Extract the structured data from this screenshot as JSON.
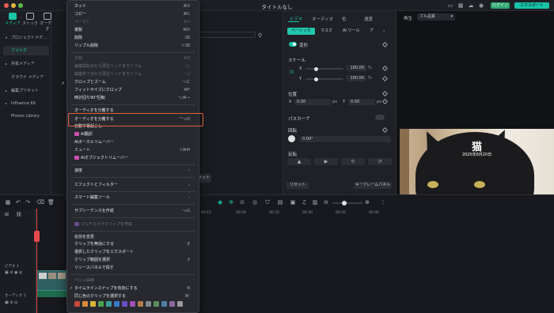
{
  "window": {
    "title": "タイトルなし",
    "login": "ログイン",
    "export": "エクスポート"
  },
  "topnav": [
    {
      "label": "メディア",
      "icon": "media-icon"
    },
    {
      "label": "ストック",
      "icon": "stock-icon"
    },
    {
      "label": "オーディオ",
      "icon": "audio-icon"
    }
  ],
  "sidebar": {
    "items": [
      {
        "label": "プロジェクトメデ…",
        "arrow": "▾",
        "selected": false
      },
      {
        "label": "フォルダ",
        "arrow": "",
        "selected": true
      },
      {
        "label": "共有メディア",
        "arrow": "▸",
        "selected": false
      },
      {
        "label": "クラウド メディア",
        "arrow": "",
        "selected": false
      },
      {
        "label": "編集プリセット",
        "arrow": "▸",
        "selected": false
      },
      {
        "label": "Influence Kit",
        "arrow": "▸",
        "selected": false
      },
      {
        "label": "Photos Library",
        "arrow": "",
        "selected": false
      }
    ],
    "partial_label": "メ",
    "import_partial": "セット"
  },
  "props": {
    "tabs": [
      "ビデオ",
      "オーディオ",
      "色",
      "速度"
    ],
    "subtabs": [
      "ベーシック",
      "マスク",
      "AI ツール",
      "ア"
    ],
    "transform_label": "変形",
    "scale_label": "スケール",
    "scale_x_value": "100.00",
    "scale_y_value": "100.00",
    "scale_unit": "%",
    "scale_x_axis": "X",
    "scale_y_axis": "Y",
    "position_label": "位置",
    "pos_x_value": "0.00",
    "pos_y_value": "0.00",
    "pos_unit": "px",
    "pos_x_axis": "X",
    "pos_y_axis": "Y",
    "perspective_label": "パスカーブ",
    "rotate_label": "回転",
    "rotate_value": "0.00°",
    "flip_label": "反転",
    "reset": "リセット",
    "keyframe_panel": "キーフレームパネル"
  },
  "preview": {
    "player": "再生",
    "quality": "フル品質",
    "overlay_title": "猫",
    "overlay_date": "2025年6月20日"
  },
  "timeline": {
    "ruler": [
      "00:00",
      "00:05",
      "00:10",
      "00:15",
      "00:20",
      "00:25",
      "00:30",
      "00:35",
      "00:40",
      "00:45",
      "00:50"
    ],
    "video_track": "ビデオ 1",
    "audio_track": "オーディオ 1"
  },
  "menu": {
    "items": [
      {
        "label": "カット",
        "shortcut": "⌘X",
        "disabled": false
      },
      {
        "label": "コピー",
        "shortcut": "⌘C",
        "disabled": false
      },
      {
        "label": "ペースト",
        "shortcut": "⌘V",
        "disabled": true
      },
      {
        "label": "複製",
        "shortcut": "⌘D",
        "disabled": false
      },
      {
        "label": "削除",
        "shortcut": "⌫",
        "disabled": false
      },
      {
        "label": "リップル削除",
        "shortcut": "⇧⌫",
        "disabled": false
      },
      {
        "label": "分割",
        "shortcut": "⌘B",
        "disabled": true
      },
      {
        "label": "編集開始点から再生ヘッドまでトリム",
        "shortcut": "⌥[",
        "disabled": true
      },
      {
        "label": "編集終了点から再生ヘッドまでトリム",
        "shortcut": "⌥]",
        "disabled": true
      },
      {
        "label": "クロップとズーム",
        "shortcut": "⌥C",
        "disabled": false
      },
      {
        "label": "フィットサイズにクロップ",
        "shortcut": "⌘F",
        "disabled": false
      },
      {
        "label": "時計回り90°回転",
        "shortcut": "⌥⌘→",
        "disabled": false
      },
      {
        "label": "オーディオを分離する",
        "shortcut": "",
        "disabled": false
      },
      {
        "label": "オーディオを分離する",
        "shortcut": "^⌥D",
        "disabled": false
      },
      {
        "label": "自動字幕起こし",
        "shortcut": "",
        "disabled": false
      },
      {
        "label": "AI翻訳",
        "shortcut": "",
        "disabled": false
      },
      {
        "label": "AIボーカルリムーバー",
        "shortcut": "",
        "disabled": false
      },
      {
        "label": "ミュート",
        "shortcut": "⇧⌘M",
        "disabled": false
      },
      {
        "label": "AIオブジェクトリムーバー",
        "shortcut": "",
        "disabled": false
      },
      {
        "label": "速度",
        "shortcut": "",
        "disabled": false
      },
      {
        "label": "エフェクトとフィルター",
        "shortcut": "",
        "disabled": false
      },
      {
        "label": "スマート編集ツール",
        "shortcut": "",
        "disabled": false
      },
      {
        "label": "サブシーケンスを作成",
        "shortcut": "⌥G",
        "disabled": false
      },
      {
        "label": "マルチカメラクリップを作成",
        "shortcut": "",
        "disabled": true
      },
      {
        "label": "名前を変更",
        "shortcut": "",
        "disabled": false
      },
      {
        "label": "クリップを無効にする",
        "shortcut": "E",
        "disabled": false
      },
      {
        "label": "選択したクリップをエクスポート",
        "shortcut": "",
        "disabled": false
      },
      {
        "label": "クリップ範囲を選択",
        "shortcut": "X",
        "disabled": false
      },
      {
        "label": "リソースパネルで探す",
        "shortcut": "",
        "disabled": false
      },
      {
        "label": "ベジェ曲線",
        "shortcut": "",
        "disabled": true
      },
      {
        "label": "タイムラインスナップを有効にする",
        "shortcut": "N",
        "disabled": false
      },
      {
        "label": "同じ色のクリップを選択する",
        "shortcut": "⌘'",
        "disabled": false
      }
    ],
    "colors": [
      "#c84a3a",
      "#d98a3b",
      "#d9b23a",
      "#4fa14f",
      "#3a9a9a",
      "#3a78c8",
      "#6a4fc8",
      "#a04fb2",
      "#b27a4f",
      "#7f8690",
      "#5e8c5e",
      "#4f7fa6",
      "#8a6a9a",
      "#9a9a9a"
    ]
  }
}
